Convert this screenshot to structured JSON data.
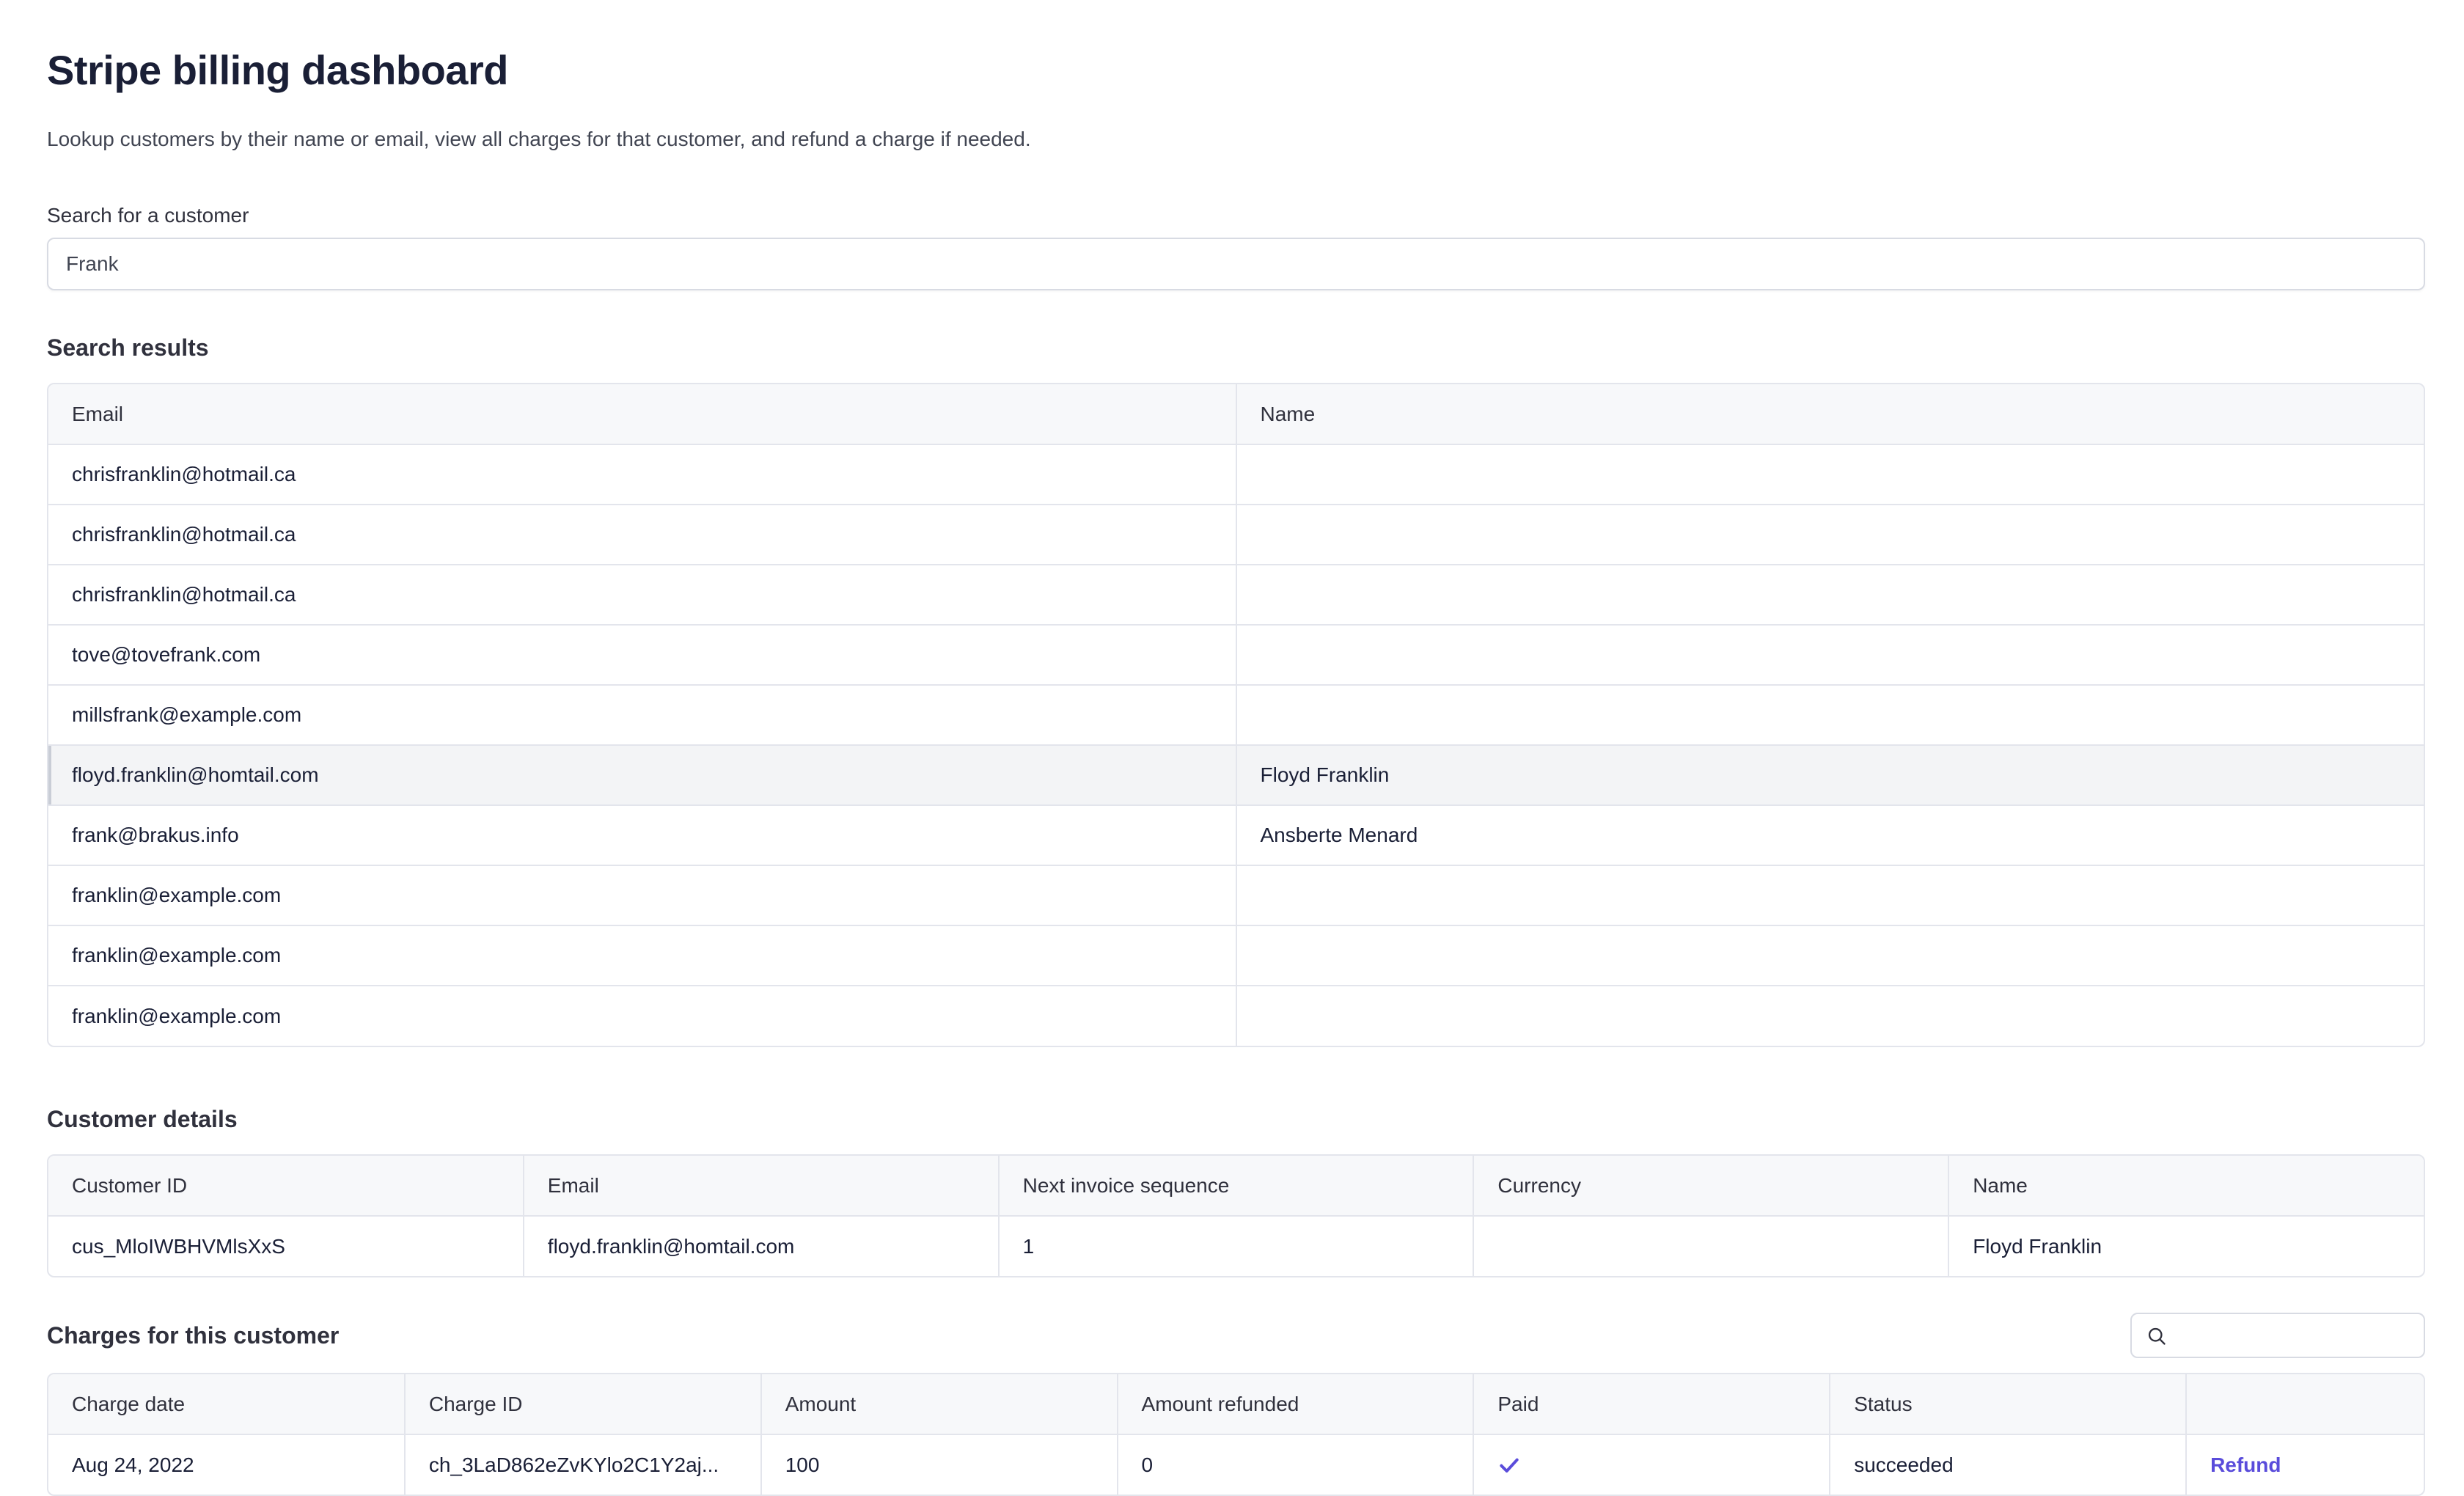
{
  "page": {
    "title": "Stripe billing dashboard",
    "subtitle": "Lookup customers by their name or email, view all charges for that customer, and refund a charge if needed."
  },
  "search": {
    "label": "Search for a customer",
    "value": "Frank"
  },
  "results": {
    "title": "Search results",
    "columns": [
      "Email",
      "Name"
    ],
    "rows": [
      {
        "email": "chrisfranklin@hotmail.ca",
        "name": ""
      },
      {
        "email": "chrisfranklin@hotmail.ca",
        "name": ""
      },
      {
        "email": "chrisfranklin@hotmail.ca",
        "name": ""
      },
      {
        "email": "tove@tovefrank.com",
        "name": ""
      },
      {
        "email": "millsfrank@example.com",
        "name": ""
      },
      {
        "email": "floyd.franklin@homtail.com",
        "name": "Floyd Franklin"
      },
      {
        "email": "frank@brakus.info",
        "name": "Ansberte Menard"
      },
      {
        "email": "franklin@example.com",
        "name": ""
      },
      {
        "email": "franklin@example.com",
        "name": ""
      },
      {
        "email": "franklin@example.com",
        "name": ""
      }
    ]
  },
  "details": {
    "title": "Customer details",
    "columns": [
      "Customer ID",
      "Email",
      "Next invoice sequence",
      "Currency",
      "Name"
    ],
    "row": [
      "cus_MloIWBHVMlsXxS",
      "floyd.franklin@homtail.com",
      "1",
      "",
      "Floyd Franklin"
    ]
  },
  "charges": {
    "title": "Charges for this customer",
    "search_placeholder": "",
    "columns": [
      "Charge date",
      "Charge ID",
      "Amount",
      "Amount refunded",
      "Paid",
      "Status",
      ""
    ],
    "rows": [
      {
        "date": "Aug 24, 2022",
        "id": "ch_3LaD862eZvKYlo2C1Y2aj...",
        "amount": "100",
        "refunded": "0",
        "paid_icon": "check-icon",
        "status": "succeeded",
        "action": "Refund"
      }
    ]
  },
  "colors": {
    "accent": "#5a4cdb",
    "border": "#e3e5ec",
    "header_bg": "#f7f8fa",
    "selected_row_bg": "#f3f4f6"
  }
}
